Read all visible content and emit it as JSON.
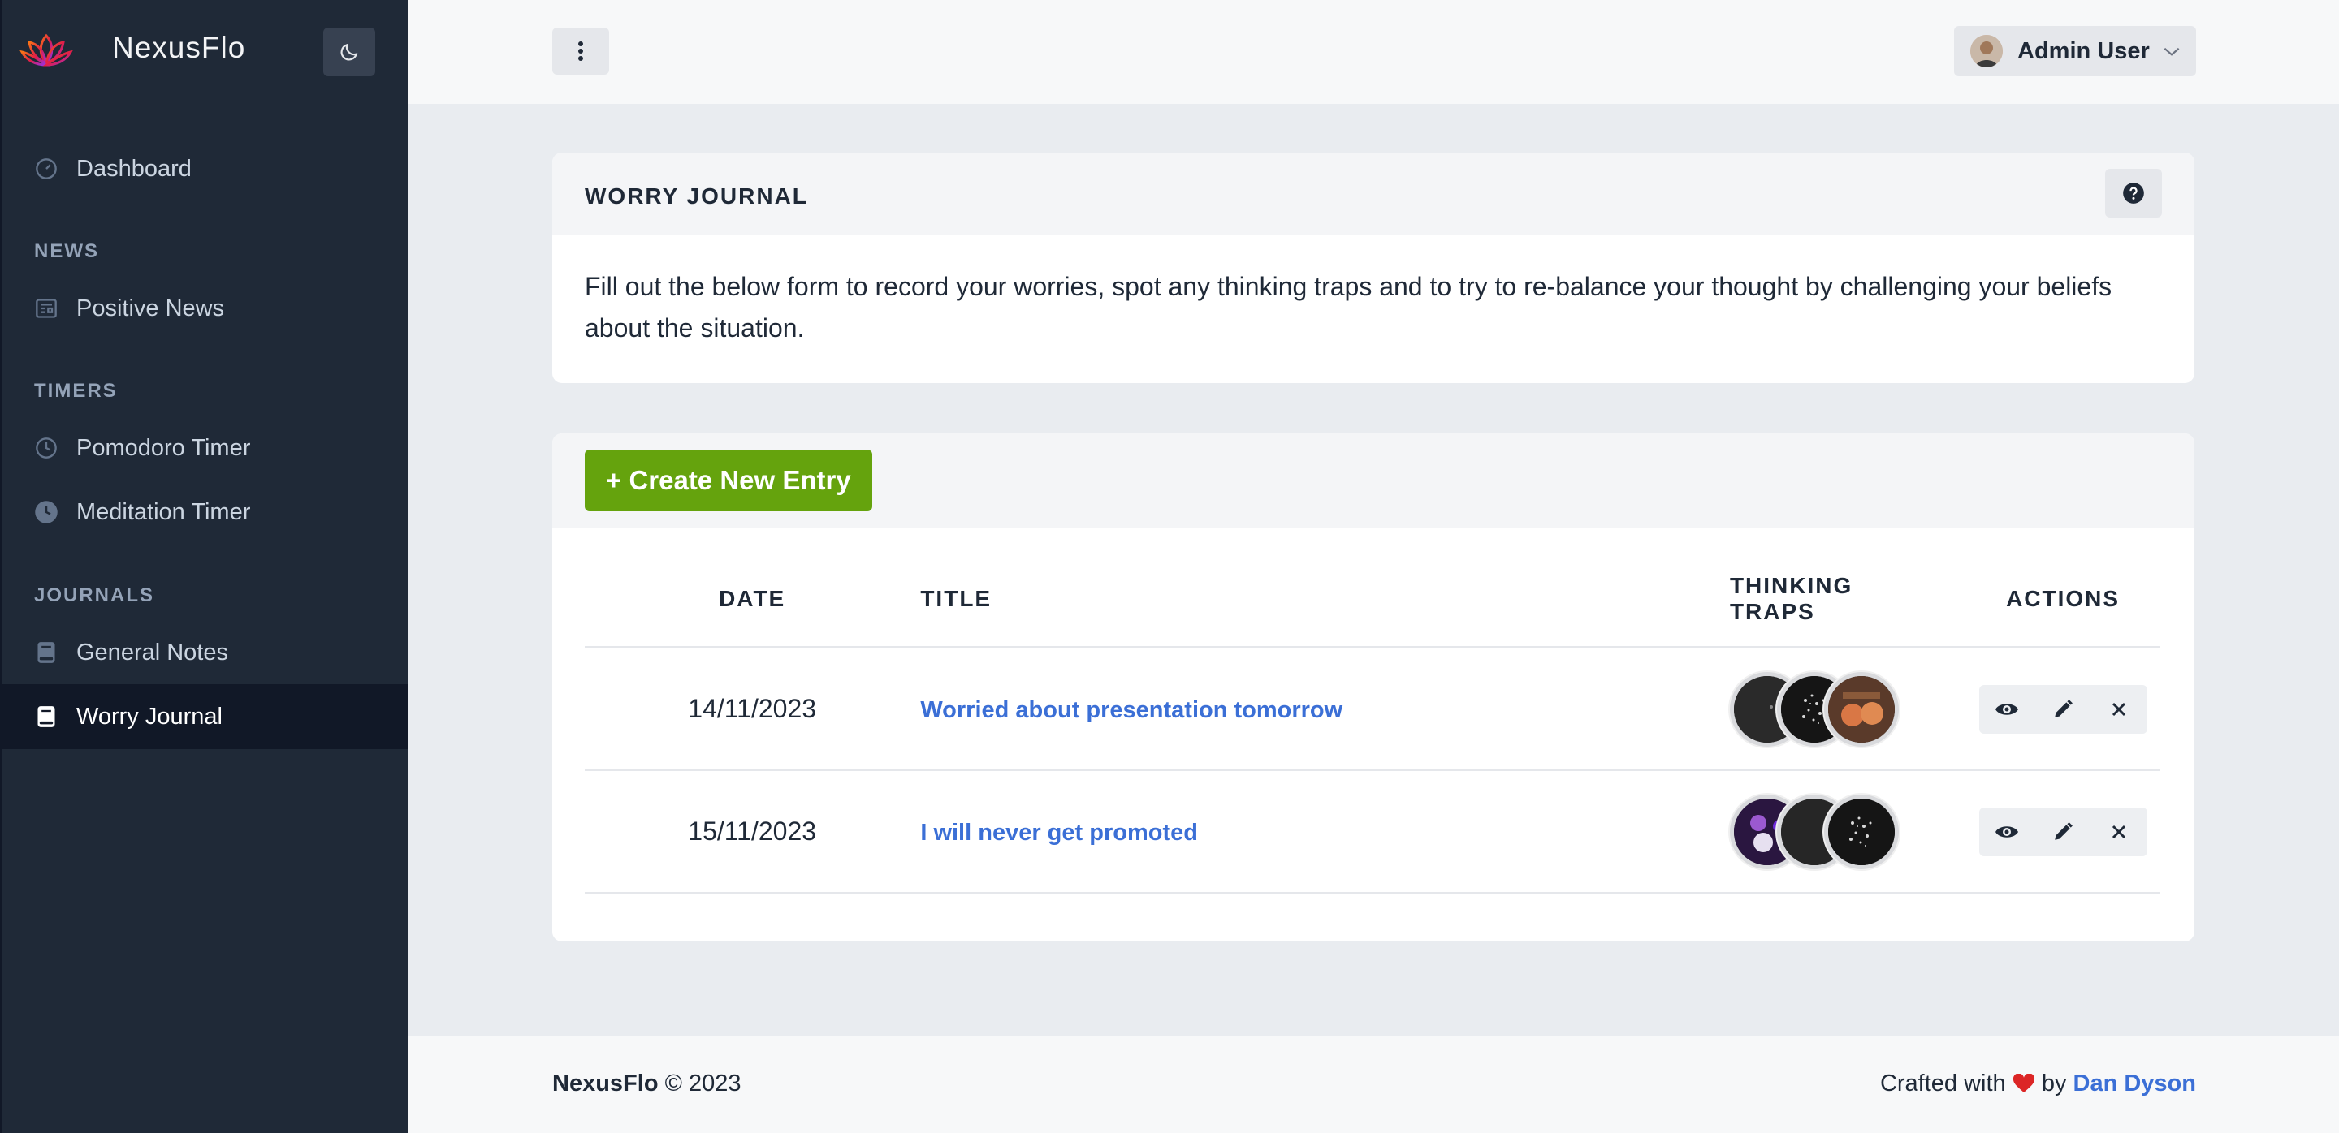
{
  "app": {
    "name": "NexusFlo"
  },
  "sidebar": {
    "dashboard": "Dashboard",
    "sections": [
      {
        "heading": "NEWS",
        "items": [
          "Positive News"
        ]
      },
      {
        "heading": "TIMERS",
        "items": [
          "Pomodoro Timer",
          "Meditation Timer"
        ]
      },
      {
        "heading": "JOURNALS",
        "items": [
          "General Notes",
          "Worry Journal"
        ]
      }
    ],
    "active_item": "Worry Journal"
  },
  "header": {
    "user_name": "Admin User"
  },
  "intro_card": {
    "title": "WORRY JOURNAL",
    "text": "Fill out the below form to record your worries, spot any thinking traps and to try to re-balance your thought by challenging your beliefs about the situation."
  },
  "entries_card": {
    "create_button": "+ Create New Entry",
    "columns": {
      "date": "DATE",
      "title": "TITLE",
      "traps_line1": "THINKING",
      "traps_line2": "TRAPS",
      "actions": "ACTIONS"
    },
    "rows": [
      {
        "date": "14/11/2023",
        "title": "Worried about presentation tomorrow"
      },
      {
        "date": "15/11/2023",
        "title": "I will never get promoted"
      }
    ]
  },
  "footer": {
    "brand": "NexusFlo",
    "copyright": "© 2023",
    "crafted": "Crafted with",
    "by": "by",
    "author": "Dan Dyson"
  },
  "colors": {
    "sidebar": "#1f2937",
    "accent_green": "#65a30d",
    "link_blue": "#3b6fd6",
    "heart": "#dc2626"
  }
}
